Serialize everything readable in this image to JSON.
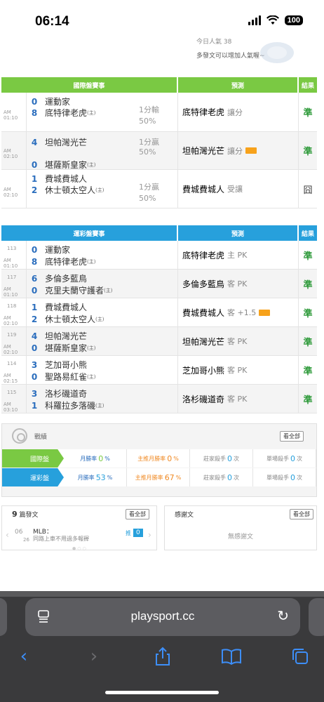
{
  "status": {
    "time": "06:14",
    "battery": "100"
  },
  "top": {
    "line1": "今日人氣 38",
    "line2": "多發文可以增加人氣喔~"
  },
  "intl_table": {
    "headers": {
      "game": "國際盤賽事",
      "pred": "預測",
      "result": "結果"
    },
    "rows": [
      {
        "time": "AM 01:10",
        "away_score": "0",
        "away": "運動家",
        "home_score": "8",
        "home": "底特律老虎",
        "host": "(主)",
        "line": "1分輸",
        "pct": "50%",
        "pick": "底特律老虎",
        "pick_sub": "讓分",
        "tag": false,
        "result": "準"
      },
      {
        "time": "AM 02:10",
        "away_score": "4",
        "away": "坦帕灣光芒",
        "home_score": "0",
        "home": "堪薩斯皇家",
        "host": "(主)",
        "line": "1分贏",
        "pct": "50%",
        "pick": "坦帕灣光芒",
        "pick_sub": "讓分",
        "tag": true,
        "result": "準"
      },
      {
        "time": "AM 02:10",
        "away_score": "1",
        "away": "費城費城人",
        "home_score": "2",
        "home": "休士頓太空人",
        "host": "(主)",
        "line": "1分贏",
        "pct": "50%",
        "pick": "費城費城人",
        "pick_sub": "受讓",
        "tag": false,
        "result": "囧"
      }
    ]
  },
  "lottery_table": {
    "headers": {
      "game": "運彩盤賽事",
      "pred": "預測",
      "result": "結果"
    },
    "rows": [
      {
        "no": "113",
        "time": "AM 01:10",
        "away_score": "0",
        "away": "運動家",
        "home_score": "8",
        "home": "底特律老虎",
        "host": "(主)",
        "pick": "底特律老虎",
        "pick_sub": "主 PK",
        "tag": false,
        "result": "準"
      },
      {
        "no": "117",
        "time": "AM 01:10",
        "away_score": "6",
        "away": "多倫多藍鳥",
        "home_score": "0",
        "home": "克里夫蘭守護者",
        "host": "(主)",
        "pick": "多倫多藍鳥",
        "pick_sub": "客 PK",
        "tag": false,
        "result": "準"
      },
      {
        "no": "118",
        "time": "AM 02:10",
        "away_score": "1",
        "away": "費城費城人",
        "home_score": "2",
        "home": "休士頓太空人",
        "host": "(主)",
        "pick": "費城費城人",
        "pick_sub": "客 +1.5",
        "tag": true,
        "result": "準"
      },
      {
        "no": "119",
        "time": "AM 02:10",
        "away_score": "4",
        "away": "坦帕灣光芒",
        "home_score": "0",
        "home": "堪薩斯皇家",
        "host": "(主)",
        "pick": "坦帕灣光芒",
        "pick_sub": "客 PK",
        "tag": false,
        "result": "準"
      },
      {
        "no": "114",
        "time": "AM 02:15",
        "away_score": "3",
        "away": "芝加哥小熊",
        "home_score": "0",
        "home": "聖路易紅雀",
        "host": "(主)",
        "pick": "芝加哥小熊",
        "pick_sub": "客 PK",
        "tag": false,
        "result": "準"
      },
      {
        "no": "115",
        "time": "AM 03:10",
        "away_score": "3",
        "away": "洛杉磯道奇",
        "home_score": "1",
        "home": "科羅拉多落磯",
        "host": "(主)",
        "pick": "洛杉磯道奇",
        "pick_sub": "客 PK",
        "tag": false,
        "result": "準"
      }
    ]
  },
  "record": {
    "title": "戰績",
    "see_all": "看全部",
    "rows": [
      {
        "label": "國際盤",
        "month_label": "月勝率",
        "month_val": "0",
        "host_label": "主推月勝率",
        "host_val": "0",
        "house_label": "莊家殺手",
        "house_val": "0",
        "single_label": "單場殺手",
        "single_val": "0",
        "unit_pct": "%",
        "unit_times": "次"
      },
      {
        "label": "運彩盤",
        "month_label": "月勝率",
        "month_val": "53",
        "host_label": "主推月勝率",
        "host_val": "67",
        "house_label": "莊家殺手",
        "house_val": "0",
        "single_label": "單場殺手",
        "single_val": "0",
        "unit_pct": "%",
        "unit_times": "次"
      }
    ]
  },
  "posts": {
    "count": "9",
    "label": "篇發文",
    "see_all": "看全部",
    "date_m": "06",
    "date_d": "26",
    "title": "MLB：",
    "sub": "同路上車不用過多報稺",
    "push_label": "推",
    "push_count": "0"
  },
  "thanks": {
    "label": "感謝文",
    "see_all": "看全部",
    "empty": "無感謝文"
  },
  "browser": {
    "url": "playsport.cc"
  }
}
